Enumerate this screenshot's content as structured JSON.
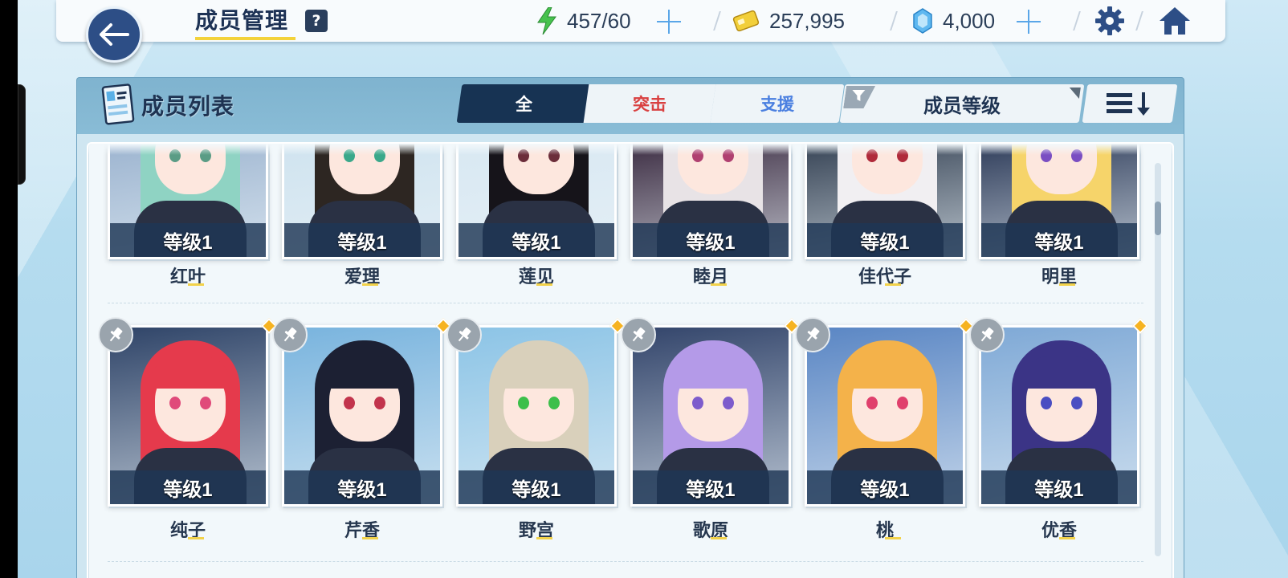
{
  "header": {
    "title": "成员管理",
    "help": "?"
  },
  "resources": {
    "ap": "457/60",
    "credits": "257,995",
    "gems": "4,000"
  },
  "panel": {
    "title": "成员列表",
    "tabs": [
      {
        "label": "全",
        "active": true
      },
      {
        "label": "突击",
        "active": false
      },
      {
        "label": "支援",
        "active": false
      }
    ],
    "filter_label": "成员等级"
  },
  "colors": {
    "accent": "#173353",
    "strike": "#d94040",
    "support": "#4a7fe0",
    "highlight": "#f3d23a",
    "new_dot": "#f6b321"
  },
  "members_row1": [
    {
      "name": "红叶",
      "level": "等级1",
      "hair": "#8fd3c3",
      "eye": "#5a9c85",
      "bg": "#9bb3cf"
    },
    {
      "name": "爱理",
      "level": "等级1",
      "hair": "#2d2622",
      "eye": "#3aa88a",
      "bg": "#cfe3ef"
    },
    {
      "name": "莲见",
      "level": "等级1",
      "hair": "#16141a",
      "eye": "#6b2d3a",
      "bg": "#d8e8f2"
    },
    {
      "name": "睦月",
      "level": "等级1",
      "hair": "#e8e3e6",
      "eye": "#b04070",
      "bg": "#3a2a40"
    },
    {
      "name": "佳代子",
      "level": "等级1",
      "hair": "#f1eff2",
      "eye": "#b02a3a",
      "bg": "#334052"
    },
    {
      "name": "明里",
      "level": "等级1",
      "hair": "#f6d46a",
      "eye": "#7a4ec2",
      "bg": "#2c3a58"
    }
  ],
  "members_row2": [
    {
      "name": "纯子",
      "level": "等级1",
      "hair": "#e53a4c",
      "eye": "#e04a7a",
      "bg": "#2f4468"
    },
    {
      "name": "芹香",
      "level": "等级1",
      "hair": "#1c2033",
      "eye": "#c2344c",
      "bg": "#79b4de"
    },
    {
      "name": "野宫",
      "level": "等级1",
      "hair": "#d9d0bb",
      "eye": "#3cbf4a",
      "bg": "#8cc4e6"
    },
    {
      "name": "歌原",
      "level": "等级1",
      "hair": "#b49ae8",
      "eye": "#7d5ccc",
      "bg": "#33456b"
    },
    {
      "name": "桃",
      "level": "等级1",
      "hair": "#f4b24a",
      "eye": "#e0406c",
      "bg": "#5a86c4"
    },
    {
      "name": "优香",
      "level": "等级1",
      "hair": "#3b3486",
      "eye": "#4a4ec2",
      "bg": "#7fa9d6"
    }
  ]
}
